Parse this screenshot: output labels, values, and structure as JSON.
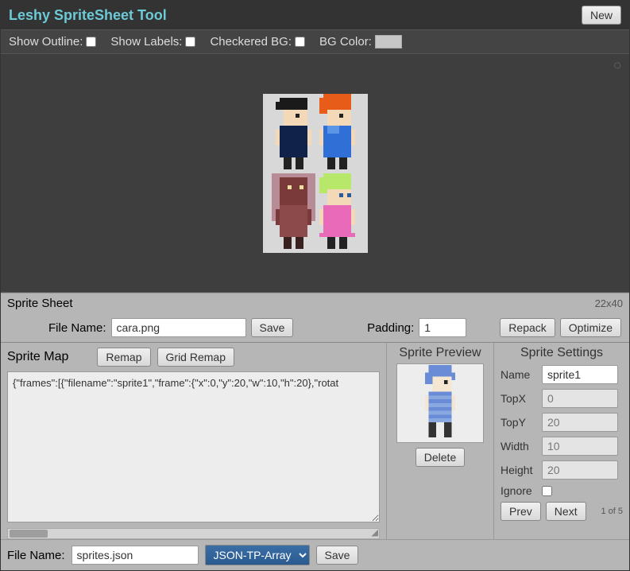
{
  "app": {
    "title": "Leshy SpriteSheet Tool",
    "new_btn": "New"
  },
  "toolbar": {
    "show_outline": "Show Outline:",
    "show_labels": "Show Labels:",
    "checkered_bg": "Checkered BG:",
    "bg_color": "BG Color:"
  },
  "spritesheet": {
    "label": "Sprite Sheet",
    "dimensions": "22x40",
    "filename_label": "File Name:",
    "filename": "cara.png",
    "save_btn": "Save",
    "padding_label": "Padding:",
    "padding": "1",
    "repack_btn": "Repack",
    "optimize_btn": "Optimize"
  },
  "spritemap": {
    "label": "Sprite Map",
    "remap_btn": "Remap",
    "grid_remap_btn": "Grid Remap",
    "content": "{\"frames\":[{\"filename\":\"sprite1\",\"frame\":{\"x\":0,\"y\":20,\"w\":10,\"h\":20},\"rotat"
  },
  "preview": {
    "label": "Sprite Preview",
    "delete_btn": "Delete"
  },
  "settings": {
    "label": "Sprite Settings",
    "name_label": "Name",
    "name": "sprite1",
    "topx_label": "TopX",
    "topx": "0",
    "topy_label": "TopY",
    "topy": "20",
    "width_label": "Width",
    "width": "10",
    "height_label": "Height",
    "height": "20",
    "ignore_label": "Ignore",
    "prev_btn": "Prev",
    "next_btn": "Next",
    "count": "1 of 5"
  },
  "export": {
    "filename_label": "File Name:",
    "filename": "sprites.json",
    "format": "JSON-TP-Array",
    "save_btn": "Save"
  }
}
